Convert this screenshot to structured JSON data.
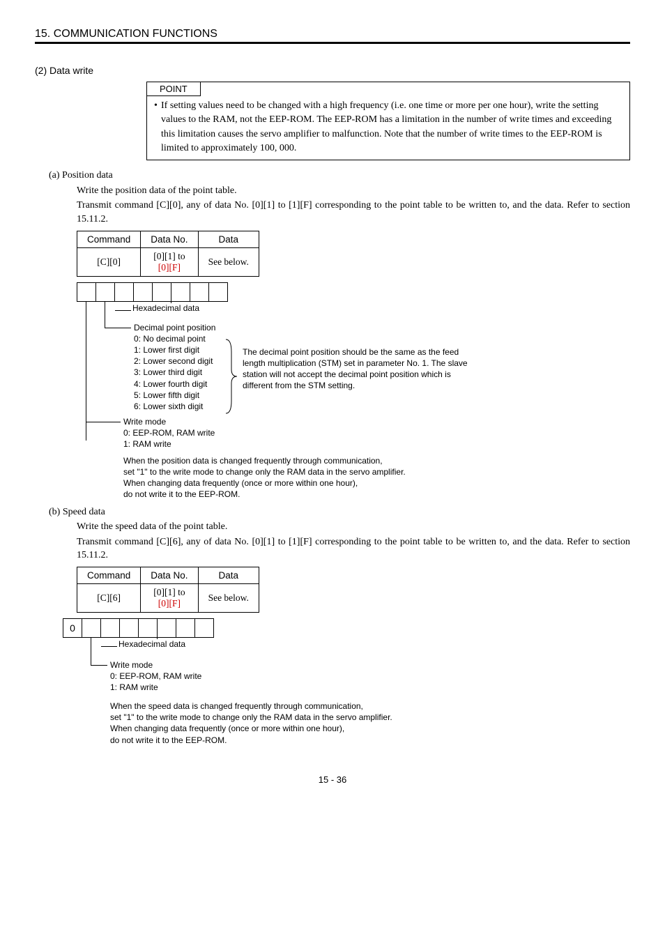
{
  "header": "15. COMMUNICATION FUNCTIONS",
  "section2": "(2) Data write",
  "point": {
    "label": "POINT",
    "text": "If setting values need to be changed with a high frequency (i.e. one time or more per one hour), write the setting values to the RAM, not the EEP-ROM. The EEP-ROM has a limitation in the number of write times and exceeding this limitation causes the servo amplifier to malfunction. Note that the number of write times to the EEP-ROM is limited to approximately 100, 000."
  },
  "a": {
    "heading": "(a) Position data",
    "line1": "Write the position data of the point table.",
    "line2": "Transmit command [C][0], any of data No. [0][1] to [1][F] corresponding to the point table to be written to, and the data. Refer to section 15.11.2.",
    "table": {
      "h1": "Command",
      "h2": "Data No.",
      "h3": "Data",
      "c1": "[C][0]",
      "c2a": "[0][1] to",
      "c2b": "[0][F]",
      "c3": "See below."
    },
    "diag": {
      "hex": "Hexadecimal data",
      "dp_title": "Decimal point position",
      "dp": [
        "0: No decimal point",
        "1: Lower first digit",
        "2: Lower second digit",
        "3: Lower third digit",
        "4: Lower fourth digit",
        "5: Lower fifth digit",
        "6: Lower sixth digit"
      ],
      "wm_title": "Write mode",
      "wm": [
        "0: EEP-ROM, RAM write",
        "1: RAM write"
      ],
      "side": "The decimal point position should be the same as the feed length multiplication (STM) set in parameter No. 1. The slave station will not accept the decimal point position which is different from the STM setting.",
      "note": [
        "When the position data is changed frequently through communication,",
        "set \"1\" to the write mode to change only the RAM data in the servo amplifier.",
        "When changing data frequently (once or more within one hour),",
        "do not write it to the EEP-ROM."
      ]
    }
  },
  "b": {
    "heading": "(b) Speed data",
    "line1": "Write the speed data of the point table.",
    "line2": "Transmit command [C][6], any of data No. [0][1] to [1][F] corresponding to the point table to be written to, and the data. Refer to section 15.11.2.",
    "table": {
      "h1": "Command",
      "h2": "Data No.",
      "h3": "Data",
      "c1": "[C][6]",
      "c2a": "[0][1] to",
      "c2b": "[0][F]",
      "c3": "See below."
    },
    "diag": {
      "cell0": "0",
      "hex": "Hexadecimal data",
      "wm_title": "Write mode",
      "wm": [
        "0: EEP-ROM, RAM write",
        "1: RAM write"
      ],
      "note": [
        "When the speed data is changed frequently through communication,",
        "set \"1\" to the write mode to change only the RAM data in the servo amplifier.",
        "When changing data frequently (once or more within one hour),",
        "do not write it to the EEP-ROM."
      ]
    }
  },
  "page": "15 -  36"
}
